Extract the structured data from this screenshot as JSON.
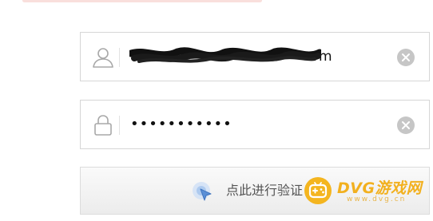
{
  "login_form": {
    "username": {
      "icon": "user-icon",
      "value": "m"
    },
    "password": {
      "icon": "lock-icon",
      "value": "•••••••••••"
    },
    "clear_icon": "clear-icon",
    "verify_button": {
      "icon": "cursor-click-icon",
      "label": "点此进行验证"
    }
  },
  "watermark": {
    "title": "DVG游戏网",
    "url": "www.dvg.cn"
  },
  "colors": {
    "border": "#d6d6d6",
    "icon_gray": "#a8a8a8",
    "clear_icon_bg": "#c6c6c6",
    "verify_icon_blue": "#5a8fd6",
    "watermark_yellow": "#f2b01e"
  }
}
